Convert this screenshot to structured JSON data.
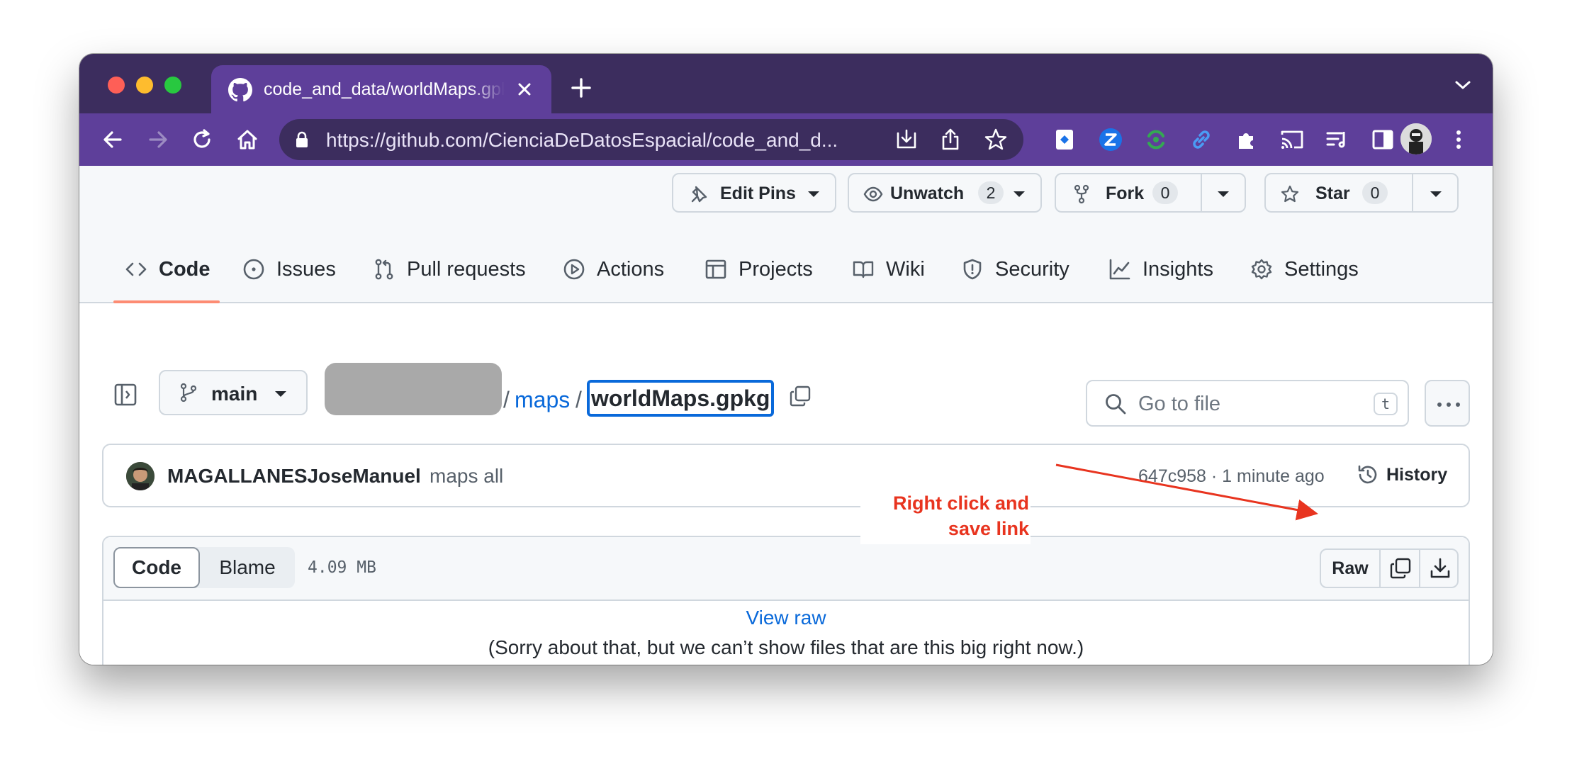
{
  "browser": {
    "tab_title": "code_and_data/worldMaps.gpkg",
    "url": "https://github.com/CienciaDeDatosEspacial/code_and_d..."
  },
  "repo_actions": {
    "edit_pins": "Edit Pins",
    "unwatch": "Unwatch",
    "unwatch_count": "2",
    "fork": "Fork",
    "fork_count": "0",
    "star": "Star",
    "star_count": "0"
  },
  "nav": {
    "tabs": [
      {
        "label": "Code",
        "icon": "code-icon",
        "active": true
      },
      {
        "label": "Issues",
        "icon": "issue-icon"
      },
      {
        "label": "Pull requests",
        "icon": "pull-request-icon"
      },
      {
        "label": "Actions",
        "icon": "play-icon"
      },
      {
        "label": "Projects",
        "icon": "table-icon"
      },
      {
        "label": "Wiki",
        "icon": "book-icon"
      },
      {
        "label": "Security",
        "icon": "shield-icon"
      },
      {
        "label": "Insights",
        "icon": "graph-icon"
      },
      {
        "label": "Settings",
        "icon": "gear-icon"
      }
    ]
  },
  "breadcrumb": {
    "branch": "main",
    "sep": "/",
    "folder": "maps",
    "file": "worldMaps.gpkg",
    "search_placeholder": "Go to file",
    "search_shortcut": "t"
  },
  "commit": {
    "author": "MAGALLANESJoseManuel",
    "message": "maps all",
    "meta": "647c958 · 1 minute ago",
    "history": "History"
  },
  "file": {
    "code_tab": "Code",
    "blame_tab": "Blame",
    "size": "4.09 MB",
    "raw": "Raw",
    "view_raw": "View raw",
    "notice": "(Sorry about that, but we can’t show files that are this big right now.)"
  },
  "annotation": {
    "line1": "Right click and",
    "line2": "save link",
    "color": "#e8341f"
  },
  "colors": {
    "chrome_frame": "#3c2d5e",
    "chrome_toolbar": "#5e3f9a",
    "link": "#0969da",
    "active_tab_underline": "#fd8c73"
  }
}
